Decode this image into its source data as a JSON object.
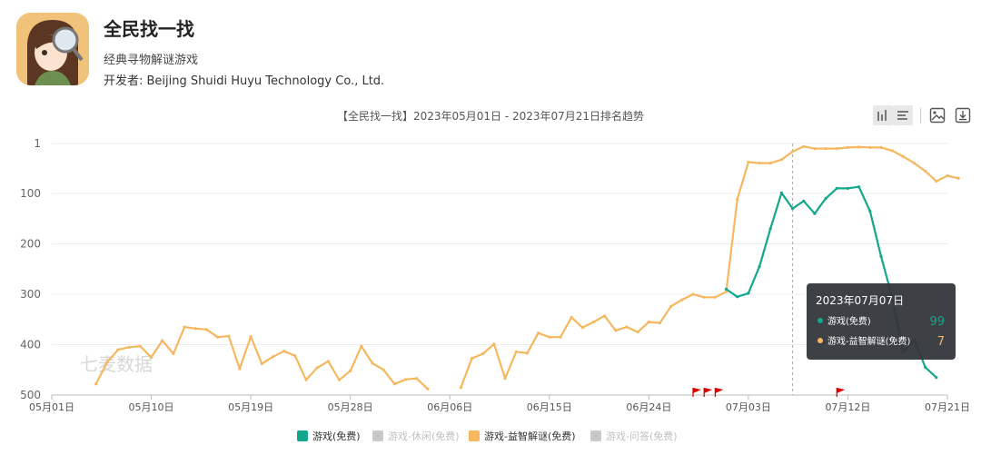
{
  "app": {
    "name": "全民找一找",
    "subtitle": "经典寻物解谜游戏",
    "developer": "开发者: Beijing Shuidi Huyu Technology Co., Ltd."
  },
  "chart_title": "【全民找一找】2023年05月01日 - 2023年07月21日排名趋势",
  "watermark": "七麦数据",
  "toolbar": {
    "icons": [
      "bar-view-icon",
      "list-view-icon",
      "image-export-icon",
      "download-icon"
    ]
  },
  "legend": [
    {
      "label": "游戏(免费)",
      "color": "#13a88b",
      "active": true
    },
    {
      "label": "游戏-休闲(免费)",
      "color": "#c8c8c8",
      "active": false
    },
    {
      "label": "游戏-益智解谜(免费)",
      "color": "#f5b860",
      "active": true
    },
    {
      "label": "游戏-问答(免费)",
      "color": "#c8c8c8",
      "active": false
    }
  ],
  "tooltip": {
    "date": "2023年07月07日",
    "rows": [
      {
        "label": "游戏(免费)",
        "value": "99",
        "color": "#13a88b"
      },
      {
        "label": "游戏-益智解谜(免费)",
        "value": "7",
        "color": "#f5b860"
      }
    ]
  },
  "chart_data": {
    "type": "line",
    "title": "【全民找一找】2023年05月01日 - 2023年07月21日排名趋势",
    "y_inverted": true,
    "ylim": [
      1,
      500
    ],
    "yticks": [
      1,
      100,
      200,
      300,
      400,
      500
    ],
    "x_range": [
      "2023-05-01",
      "2023-07-21"
    ],
    "xtick_labels": [
      "05月01日",
      "05月10日",
      "05月19日",
      "05月28日",
      "06月06日",
      "06月15日",
      "06月24日",
      "07月03日",
      "07月12日",
      "07月21日"
    ],
    "series": [
      {
        "name": "游戏(免费)",
        "color": "#13a88b",
        "start_date": "2023-07-01",
        "values": [
          290,
          305,
          298,
          245,
          170,
          99,
          130,
          115,
          140,
          110,
          90,
          90,
          87,
          135,
          225,
          305,
          415,
          390,
          445,
          465
        ]
      },
      {
        "name": "游戏-益智解谜(免费)",
        "color": "#f5b860",
        "start_date": "2023-05-05",
        "values": [
          478,
          435,
          410,
          405,
          403,
          425,
          392,
          418,
          365,
          368,
          370,
          385,
          383,
          448,
          384,
          438,
          424,
          413,
          422,
          470,
          446,
          433,
          470,
          452,
          403,
          437,
          450,
          478,
          469,
          467,
          488,
          null,
          null,
          485,
          427,
          418,
          399,
          467,
          414,
          417,
          377,
          385,
          385,
          346,
          366,
          355,
          343,
          372,
          365,
          375,
          355,
          357,
          324,
          311,
          300,
          306,
          306,
          295,
          112,
          38,
          40,
          40,
          33,
          17,
          7,
          11,
          11,
          11,
          9,
          8,
          9,
          9,
          15,
          27,
          40,
          56,
          76,
          65,
          70
        ]
      }
    ],
    "markers": {
      "type": "red-flag",
      "dates": [
        "2023-06-28",
        "2023-06-29",
        "2023-06-30",
        "2023-07-11"
      ]
    }
  }
}
